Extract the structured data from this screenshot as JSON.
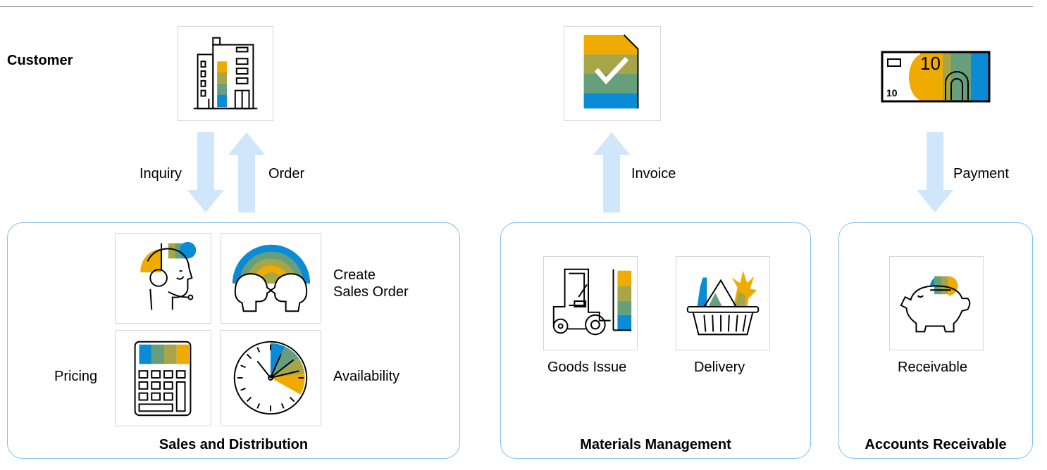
{
  "customer": {
    "label": "Customer"
  },
  "flows": {
    "inquiry": "Inquiry",
    "order": "Order",
    "invoice": "Invoice",
    "payment": "Payment"
  },
  "sales": {
    "title": "Sales and Distribution",
    "create_order": "Create\nSales Order",
    "pricing": "Pricing",
    "availability": "Availability"
  },
  "materials": {
    "title": "Materials Management",
    "goods_issue": "Goods Issue",
    "delivery": "Delivery"
  },
  "receivables": {
    "title": "Accounts Receivable",
    "receivable": "Receivable"
  },
  "money_note": {
    "value_large": "10",
    "value_small": "10"
  },
  "colors": {
    "panel_border": "#7fc1f0",
    "arrow": "#cfe6fb",
    "gold": "#f0ab00",
    "olive": "#a6a548",
    "green": "#679e7c",
    "blue": "#0a8bd6"
  }
}
